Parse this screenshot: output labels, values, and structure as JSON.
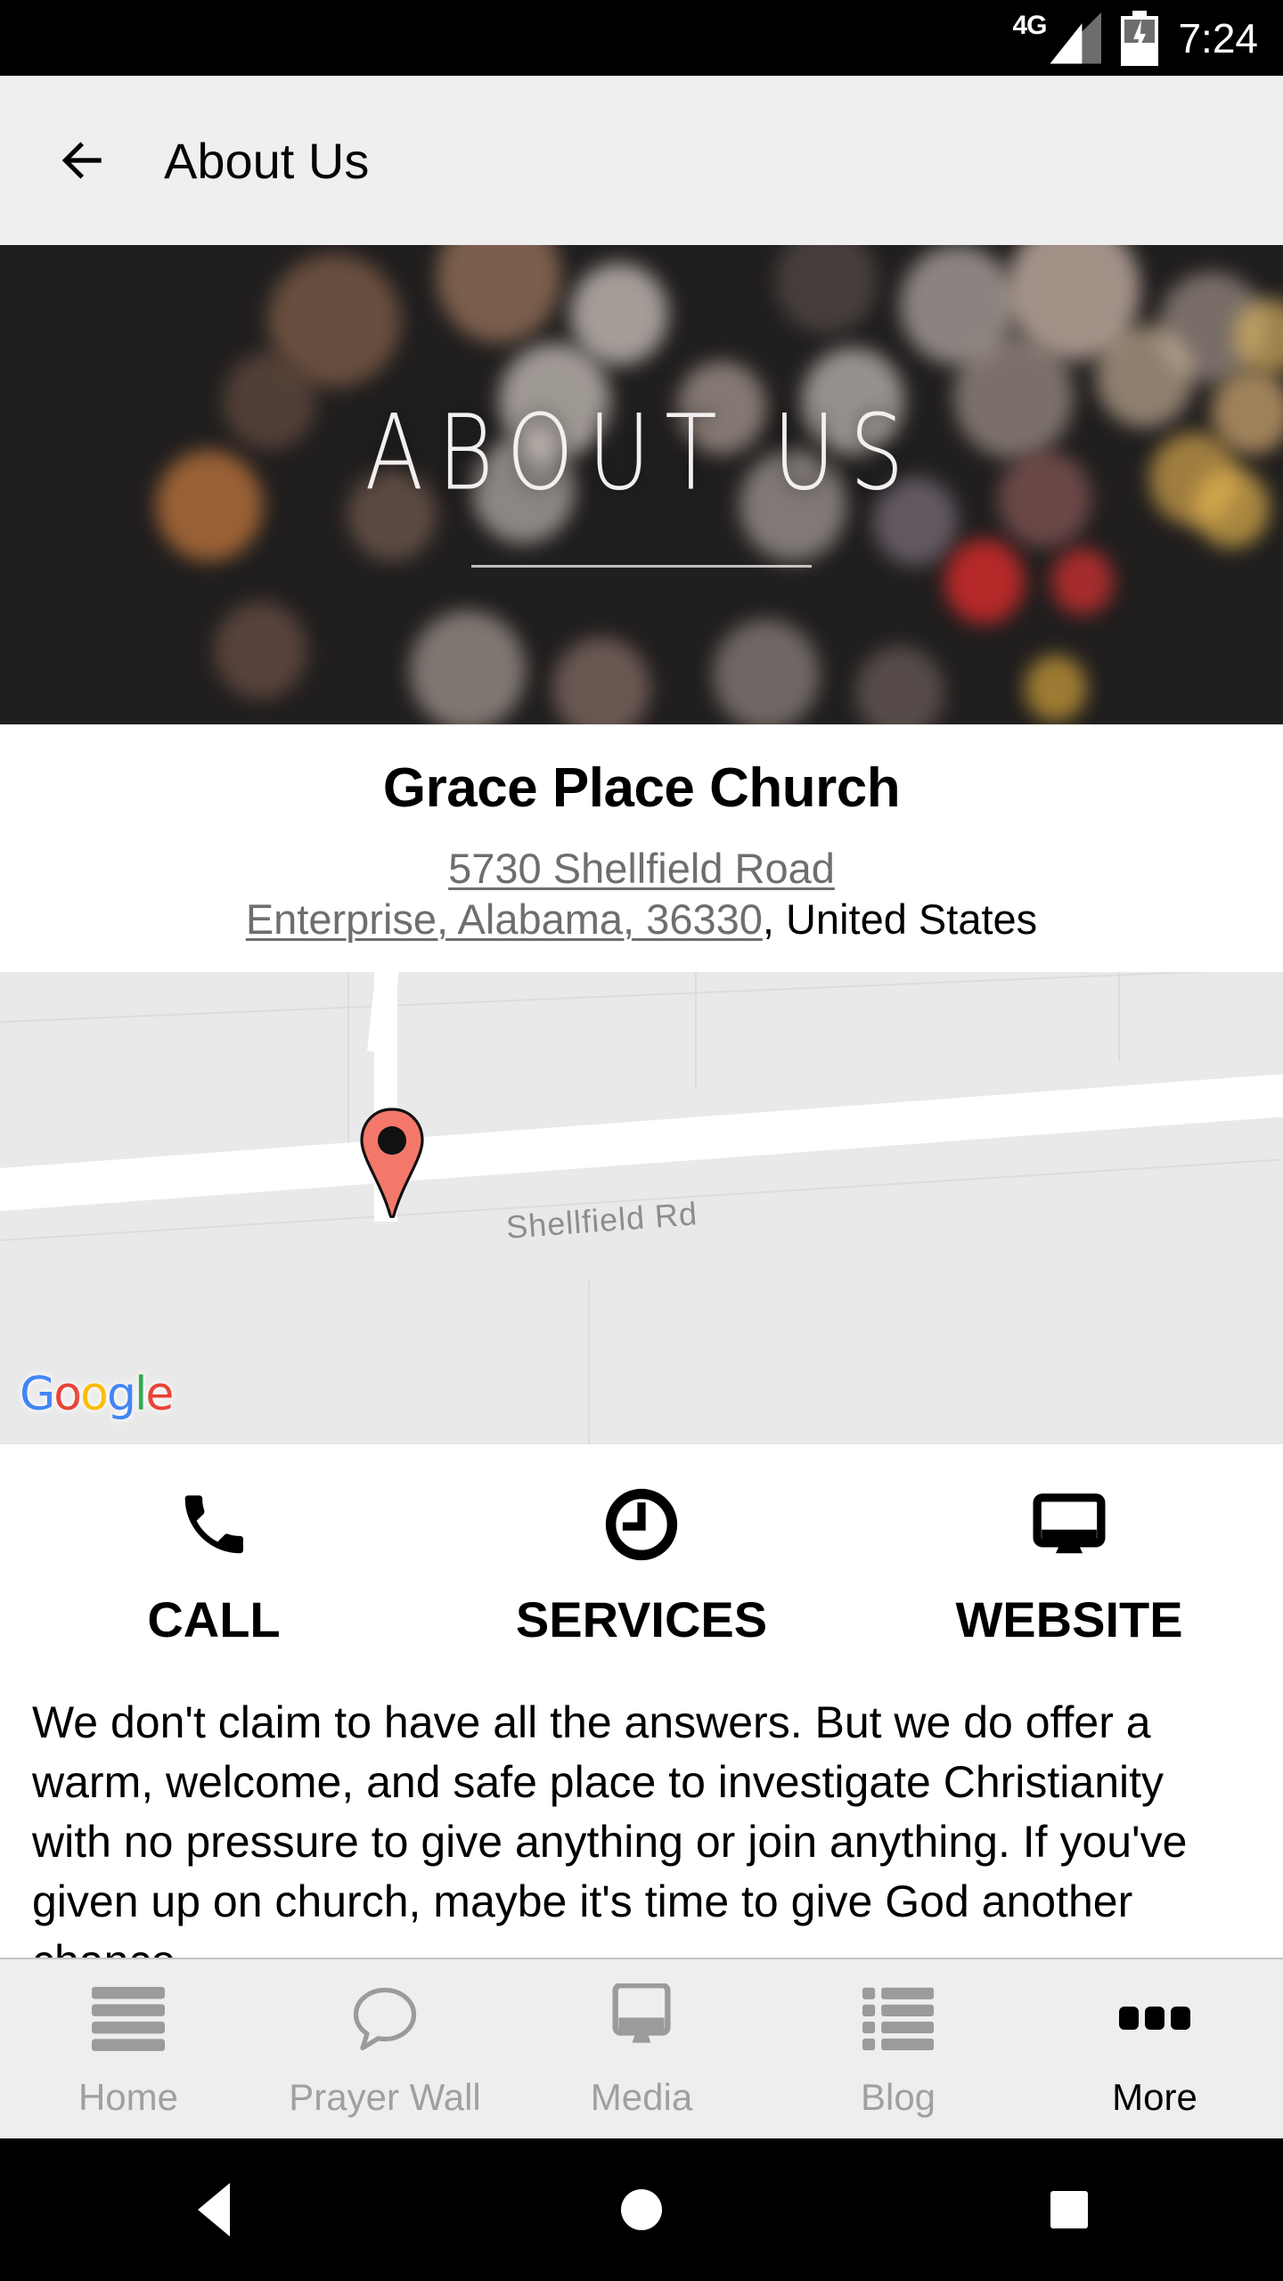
{
  "statusbar": {
    "network": "4G",
    "time": "7:24",
    "signal_icon": "signal-bars-icon",
    "battery_icon": "battery-charging-icon"
  },
  "appbar": {
    "back_icon": "back-arrow-icon",
    "title": "About Us"
  },
  "hero": {
    "title": "ABOUT US",
    "background": "bokeh-lights-photo"
  },
  "info": {
    "name": "Grace Place Church",
    "address_line1": "5730 Shellfield Road",
    "address_line2": "Enterprise, Alabama, 36330",
    "address_tail": ", United States"
  },
  "map": {
    "road_label": "Shellfield Rd",
    "pin_icon": "map-pin-icon",
    "attribution": "Google",
    "attribution_letters": [
      "G",
      "o",
      "o",
      "g",
      "l",
      "e"
    ],
    "colors": {
      "pin": "#f4786a",
      "blue": "#4285f4",
      "red": "#ea4335",
      "yellow": "#fbbc05",
      "green": "#34a853",
      "land": "#e9e9e9",
      "road": "#ffffff"
    }
  },
  "actions": [
    {
      "label": "CALL",
      "icon": "phone-icon"
    },
    {
      "label": "SERVICES",
      "icon": "clock-icon"
    },
    {
      "label": "WEBSITE",
      "icon": "monitor-icon"
    }
  ],
  "body": {
    "paragraph": "We don't claim to have all the answers. But we do offer a warm, welcome, and safe place to investigate Christianity with no pressure to give anything or join anything. If you've given up on church, maybe it's time to give God another chance."
  },
  "bottomnav": [
    {
      "label": "Home",
      "icon": "stacked-bars-icon",
      "active": false
    },
    {
      "label": "Prayer Wall",
      "icon": "speech-bubble-icon",
      "active": false
    },
    {
      "label": "Media",
      "icon": "device-screen-icon",
      "active": false
    },
    {
      "label": "Blog",
      "icon": "list-icon",
      "active": false
    },
    {
      "label": "More",
      "icon": "three-dots-icon",
      "active": true
    }
  ],
  "androidnav": {
    "back_icon": "android-back-icon",
    "home_icon": "android-home-icon",
    "recents_icon": "android-recents-icon"
  }
}
